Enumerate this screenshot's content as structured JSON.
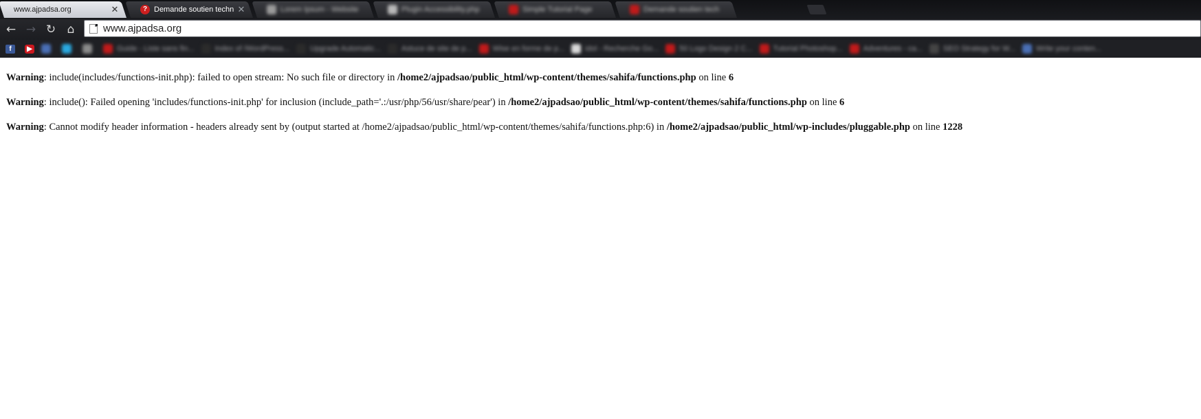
{
  "tabs": [
    {
      "title": "www.ajpadsa.org",
      "active": true,
      "close": "✕"
    },
    {
      "title": "Demande soutien techniq",
      "favicon": "question-icon",
      "close": "✕"
    }
  ],
  "blurred_tabs": [
    {
      "title": "Lorem Ipsum - Website",
      "fav_color": "#9a9a9a"
    },
    {
      "title": "Plugin Accessibility.php",
      "fav_color": "#b8b8b8"
    },
    {
      "title": "Simple Tutorial Page",
      "fav_color": "#c01a1a"
    },
    {
      "title": "Demande soutien tech",
      "fav_color": "#c01a1a"
    }
  ],
  "toolbar": {
    "back_icon": "←",
    "forward_icon": "→",
    "reload_icon": "↻",
    "home_icon": "⌂",
    "url": "www.ajpadsa.org"
  },
  "bookmarks_bar": {
    "facebook_icon": "f",
    "youtube_icon": "▶",
    "blurred_items": [
      {
        "text": "",
        "color": "#4a6fb5"
      },
      {
        "text": "",
        "color": "#2aa9e0"
      },
      {
        "text": "",
        "color": "#8a8a8a"
      },
      {
        "text": "Guide - Liste sans fin...",
        "color": "#c01a1a"
      },
      {
        "text": "Index of /WordPress...",
        "color": "#2b2b2b"
      },
      {
        "text": "Upgrade Automatic...",
        "color": "#2b2b2b"
      },
      {
        "text": "Astuce de site de p...",
        "color": "#2b2b2b"
      },
      {
        "text": "Wise en forme de p...",
        "color": "#c01a1a"
      },
      {
        "text": "idol - Recherche Go...",
        "color": "#d9d9d9"
      },
      {
        "text": "50 Logo Design 2 C...",
        "color": "#c01a1a"
      },
      {
        "text": "Tutorial Photoshop...",
        "color": "#c01a1a"
      },
      {
        "text": "Adventures - ca...",
        "color": "#c01a1a"
      },
      {
        "text": "SEO Strategy for W...",
        "color": "#444444"
      },
      {
        "text": "Write your conten...",
        "color": "#4a6fb5"
      }
    ]
  },
  "warnings": [
    {
      "label": "Warning",
      "t1": ": include(includes/functions-init.php): failed to open stream: No such file or directory in ",
      "b1": "/home2/ajpadsao/public_html/wp-content/themes/sahifa/functions.php",
      "t2": " on line ",
      "b2": "6"
    },
    {
      "label": "Warning",
      "t1": ": include(): Failed opening 'includes/functions-init.php' for inclusion (include_path='.:/usr/php/56/usr/share/pear') in ",
      "b1": "/home2/ajpadsao/public_html/wp-content/themes/sahifa/functions.php",
      "t2": " on line ",
      "b2": "6"
    },
    {
      "label": "Warning",
      "t1": ": Cannot modify header information - headers already sent by (output started at /home2/ajpadsao/public_html/wp-content/themes/sahifa/functions.php:6) in ",
      "b1": "/home2/ajpadsao/public_html/wp-includes/pluggable.php",
      "t2": " on line ",
      "b2": "1228"
    }
  ]
}
